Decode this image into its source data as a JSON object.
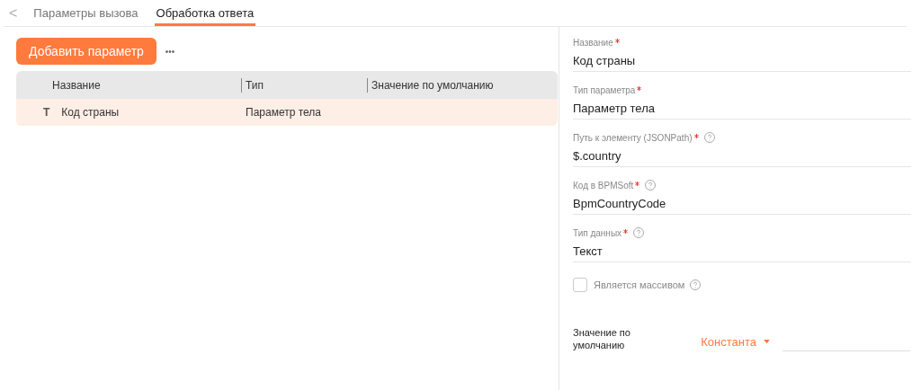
{
  "back": "<",
  "tabs": [
    {
      "label": "Параметры вызова",
      "selected": false
    },
    {
      "label": "Обработка ответа",
      "selected": true
    }
  ],
  "toolbar": {
    "add_button": "Добавить параметр",
    "more": "•••"
  },
  "table": {
    "columns": [
      "Название",
      "Тип",
      "Значение по умолчанию"
    ],
    "rows": [
      {
        "icon": "T",
        "name": "Код страны",
        "type": "Параметр тела",
        "selected": true
      }
    ]
  },
  "form": {
    "fields": [
      {
        "label": "Название",
        "required": true,
        "help": false,
        "value": "Код страны"
      },
      {
        "label": "Тип параметра",
        "required": true,
        "help": false,
        "value": "Параметр тела"
      },
      {
        "label": "Путь к элементу (JSONPath)",
        "required": true,
        "help": true,
        "value": "$.country"
      },
      {
        "label": "Код в BPMSoft",
        "required": true,
        "help": true,
        "value": "BpmCountryCode"
      },
      {
        "label": "Тип данных",
        "required": true,
        "help": true,
        "value": "Текст"
      }
    ],
    "checkbox": {
      "label": "Является массивом",
      "checked": false,
      "help": true
    },
    "default": {
      "label": "Значение по умолчанию",
      "mode": "Константа"
    }
  }
}
